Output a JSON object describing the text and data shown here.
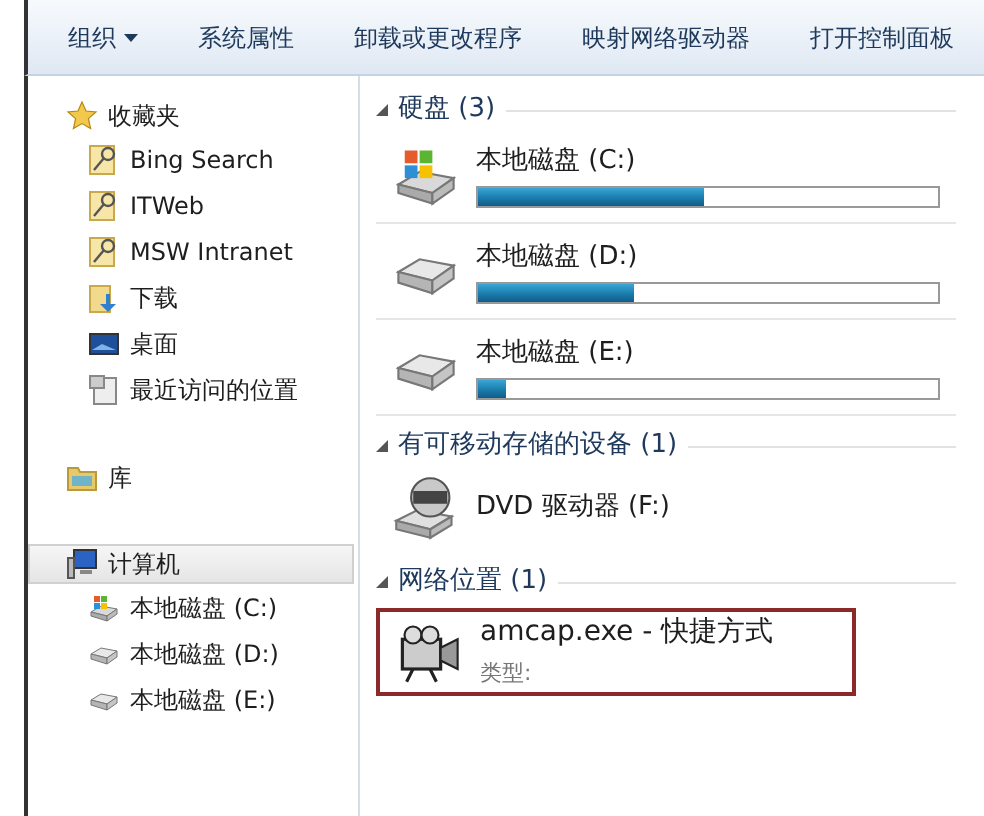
{
  "toolbar": [
    {
      "label": "组织",
      "has_menu": true
    },
    {
      "label": "系统属性",
      "has_menu": false
    },
    {
      "label": "卸载或更改程序",
      "has_menu": false
    },
    {
      "label": "映射网络驱动器",
      "has_menu": false
    },
    {
      "label": "打开控制面板",
      "has_menu": false
    }
  ],
  "sidebar": {
    "groups": [
      {
        "label": "收藏夹",
        "kind": "star",
        "selected": false,
        "children": [
          {
            "label": "Bing Search",
            "kind": "link"
          },
          {
            "label": "ITWeb",
            "kind": "link"
          },
          {
            "label": "MSW Intranet",
            "kind": "link"
          },
          {
            "label": "下载",
            "kind": "download"
          },
          {
            "label": "桌面",
            "kind": "desktop"
          },
          {
            "label": "最近访问的位置",
            "kind": "recent"
          }
        ]
      },
      {
        "label": "库",
        "kind": "library",
        "selected": false
      },
      {
        "label": "计算机",
        "kind": "computer",
        "selected": true,
        "children": [
          {
            "label": "本地磁盘 (C:)",
            "kind": "system-drive"
          },
          {
            "label": "本地磁盘 (D:)",
            "kind": "drive"
          },
          {
            "label": "本地磁盘 (E:)",
            "kind": "drive"
          }
        ]
      }
    ]
  },
  "sections": [
    {
      "title": "硬盘 (3)",
      "items": [
        {
          "kind": "system-drive",
          "name": "本地磁盘 (C:)",
          "level": 0.49,
          "selected": false
        },
        {
          "kind": "drive",
          "name": "本地磁盘 (D:)",
          "level": 0.34,
          "selected": false
        },
        {
          "kind": "drive",
          "name": "本地磁盘 (E:)",
          "level": 0.06,
          "selected": false
        }
      ]
    },
    {
      "title": "有可移动存储的设备 (1)",
      "items": [
        {
          "kind": "dvd",
          "name": "DVD 驱动器 (F:)",
          "selected": false
        }
      ]
    },
    {
      "title": "网络位置 (1)",
      "items": [
        {
          "kind": "shortcut",
          "name": "amcap.exe - 快捷方式",
          "detail": "类型:",
          "selected": true
        }
      ]
    }
  ]
}
